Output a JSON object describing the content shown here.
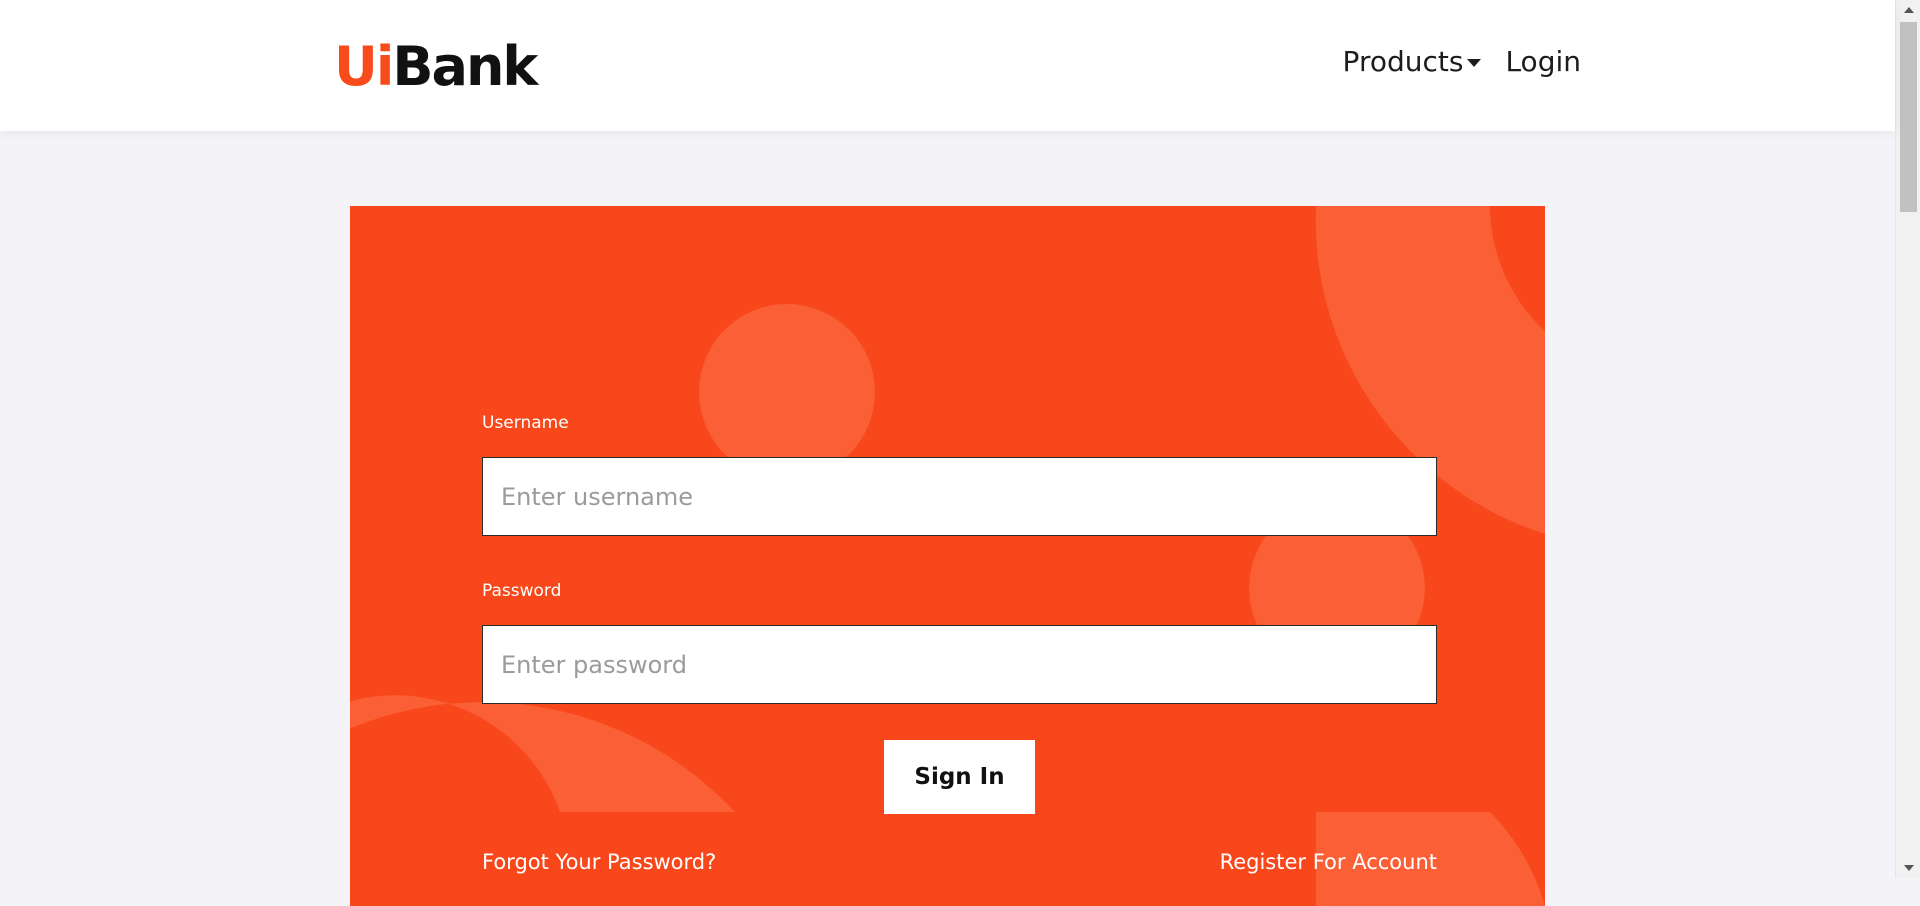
{
  "brand": {
    "logo_prefix": "Ui",
    "logo_suffix": "Bank",
    "accent_color": "#f74b1c"
  },
  "nav": {
    "products_label": "Products",
    "login_label": "Login"
  },
  "login_form": {
    "username_label": "Username",
    "username_placeholder": "Enter username",
    "username_value": "",
    "password_label": "Password",
    "password_placeholder": "Enter password",
    "password_value": "",
    "signin_label": "Sign In",
    "forgot_label": "Forgot Your Password?",
    "register_label": "Register For Account"
  },
  "colors": {
    "panel_bg": "#f7471b",
    "decoration": "#fb5f35",
    "page_bg": "#f4f4f8"
  },
  "icons": {
    "products_dropdown": "caret-down-icon"
  }
}
